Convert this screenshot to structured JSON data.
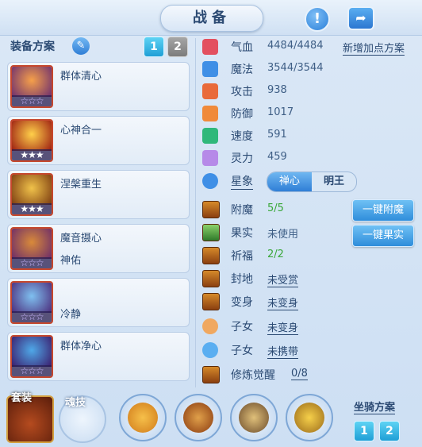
{
  "header": {
    "title": "战备",
    "info_icon": "info-icon",
    "share_icon": "share-icon"
  },
  "equipment": {
    "plan_label": "装备方案",
    "plan_buttons": [
      "1",
      "2"
    ],
    "cards": [
      {
        "name": "群体清心",
        "sub": "",
        "stars_filled": 0,
        "stars_total": 3
      },
      {
        "name": "心神合一",
        "sub": "",
        "stars_filled": 3,
        "stars_total": 3
      },
      {
        "name": "涅槃重生",
        "sub": "",
        "stars_filled": 3,
        "stars_total": 3
      },
      {
        "name": "魔音摄心",
        "sub": "神佑",
        "stars_filled": 0,
        "stars_total": 3
      },
      {
        "name": "",
        "sub": "冷静",
        "stars_filled": 0,
        "stars_total": 3
      },
      {
        "name": "群体净心",
        "sub": "",
        "stars_filled": 0,
        "stars_total": 3
      }
    ]
  },
  "stats": [
    {
      "label": "气血",
      "value": "4484/4484",
      "icon": "heart-icon",
      "color": "#e3505f"
    },
    {
      "label": "魔法",
      "value": "3544/3544",
      "icon": "mana-icon",
      "color": "#3f8fe6"
    },
    {
      "label": "攻击",
      "value": "938",
      "icon": "attack-icon",
      "color": "#e96a3a"
    },
    {
      "label": "防御",
      "value": "1017",
      "icon": "defense-icon",
      "color": "#f08a3a"
    },
    {
      "label": "速度",
      "value": "591",
      "icon": "speed-icon",
      "color": "#2fb87a"
    },
    {
      "label": "灵力",
      "value": "459",
      "icon": "spirit-icon",
      "color": "#b68ae8"
    }
  ],
  "add_points_link": "新增加点方案",
  "constellation": {
    "label": "星象",
    "options": [
      "禅心",
      "明王"
    ],
    "selected": "禅心"
  },
  "features": [
    {
      "label": "附魔",
      "value": "5/5",
      "style": "green",
      "icon": "enchant-icon"
    },
    {
      "label": "果实",
      "value": "未使用",
      "style": "plain",
      "icon": "fruit-icon"
    },
    {
      "label": "祈福",
      "value": "2/2",
      "style": "green",
      "icon": "blessing-icon"
    },
    {
      "label": "封地",
      "value": "未受赏",
      "style": "link",
      "icon": "fief-icon"
    },
    {
      "label": "变身",
      "value": "未变身",
      "style": "link",
      "icon": "transform-icon"
    },
    {
      "label": "子女",
      "value": "未变身",
      "style": "link",
      "icon": "child-icon"
    },
    {
      "label": "子女",
      "value": "未携带",
      "style": "link",
      "icon": "child2-icon"
    },
    {
      "label": "修炼觉醒",
      "value": "0/8",
      "style": "link",
      "icon": "awaken-icon"
    }
  ],
  "buttons": {
    "one_click_enchant": "一键附魔",
    "one_click_fruit": "一键果实"
  },
  "bottom": {
    "suit_label": "套装",
    "soul_label": "魂技",
    "mount_plan_label": "坐骑方案",
    "mount_plan_buttons": [
      "1",
      "2"
    ]
  }
}
